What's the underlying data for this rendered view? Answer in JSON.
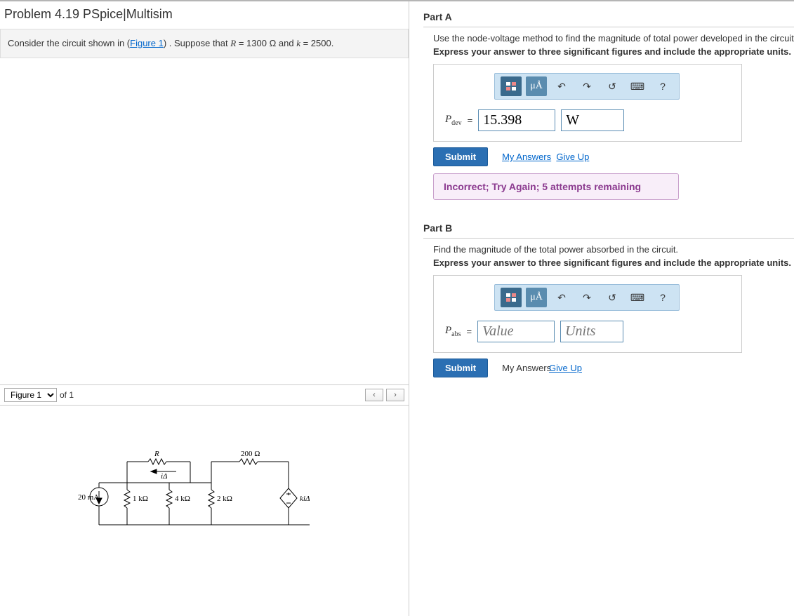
{
  "problem": {
    "title": "Problem 4.19 PSpice|Multisim",
    "intro_prefix": "Consider the circuit shown in (",
    "intro_link": "Figure 1",
    "intro_suffix": ") . Suppose that ",
    "R_var": "R",
    "R_val": " = 1300 ",
    "ohm": "Ω",
    "and": " and ",
    "k_var": "k",
    "k_val": " = 2500."
  },
  "figure": {
    "selector_label": "Figure 1",
    "of_label": "of 1",
    "labels": {
      "src": "20 mA",
      "R": "R",
      "iD": "iΔ",
      "r1": "1 kΩ",
      "r2": "4 kΩ",
      "r3": "2 kΩ",
      "r4": "200 Ω",
      "dep": "kiΔ"
    }
  },
  "toolbar": {
    "units_btn": "μÅ",
    "help": "?"
  },
  "partA": {
    "header": "Part A",
    "instr": "Use the node-voltage method to find the magnitude of total power developed in the circuit",
    "instr2": "Express your answer to three significant figures and include the appropriate units.",
    "var": "P",
    "sub": "dev",
    "eq": " = ",
    "value": "15.398",
    "units": "W",
    "submit": "Submit",
    "my_answers": "My Answers",
    "give_up": "Give Up",
    "feedback": "Incorrect; Try Again; 5 attempts remaining"
  },
  "partB": {
    "header": "Part B",
    "instr": "Find the magnitude of the total power absorbed in the circuit.",
    "instr2": "Express your answer to three significant figures and include the appropriate units.",
    "var": "P",
    "sub": "abs",
    "eq": " = ",
    "value_ph": "Value",
    "units_ph": "Units",
    "submit": "Submit",
    "my_answers": "My Answers",
    "give_up": "Give Up"
  }
}
